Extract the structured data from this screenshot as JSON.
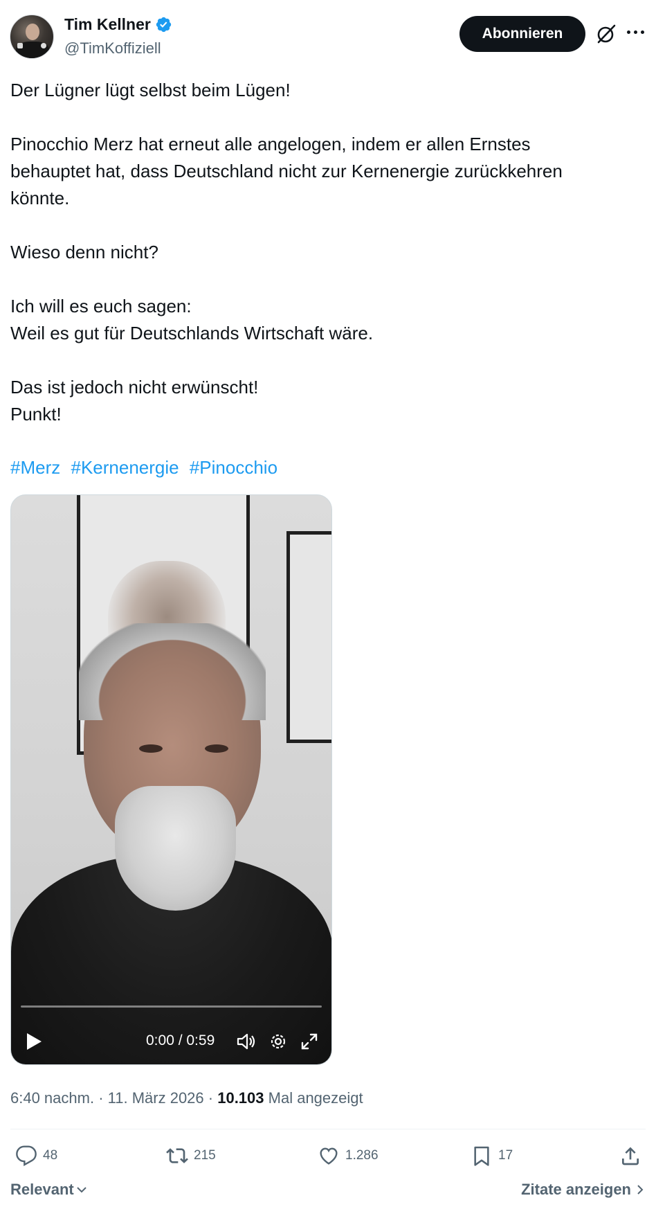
{
  "author": {
    "display_name": "Tim Kellner",
    "handle": "@TimKoffiziell",
    "verified": true
  },
  "header": {
    "follow_label": "Abonnieren"
  },
  "tweet": {
    "lines": [
      "Der Lügner lügt selbst beim Lügen!",
      "",
      "Pinocchio Merz hat erneut alle angelogen, indem er allen Ernstes",
      "behauptet hat, dass Deutschland nicht zur Kernenergie zurückkehren",
      "könnte.",
      "",
      "Wieso denn nicht?",
      "",
      "Ich will es euch sagen:",
      "Weil es gut für Deutschlands Wirtschaft wäre.",
      "",
      "Das ist jedoch nicht erwünscht!",
      "Punkt!"
    ],
    "hashtags": [
      "#Merz",
      "#Kernenergie",
      "#Pinocchio"
    ]
  },
  "video": {
    "time": "0:00 / 0:59",
    "progress": 0
  },
  "meta": {
    "time": "6:40 nachm.",
    "separator": " · ",
    "date": "11. März 2026",
    "views": "10.103",
    "views_label": "Mal angezeigt"
  },
  "actions": {
    "replies": "48",
    "reposts": "215",
    "likes": "1.286",
    "bookmarks": "17"
  },
  "footer": {
    "sort_label": "Relevant",
    "quotes_label": "Zitate anzeigen"
  },
  "colors": {
    "accent": "#1d9bf0",
    "text": "#0f1419",
    "secondary": "#536471"
  }
}
